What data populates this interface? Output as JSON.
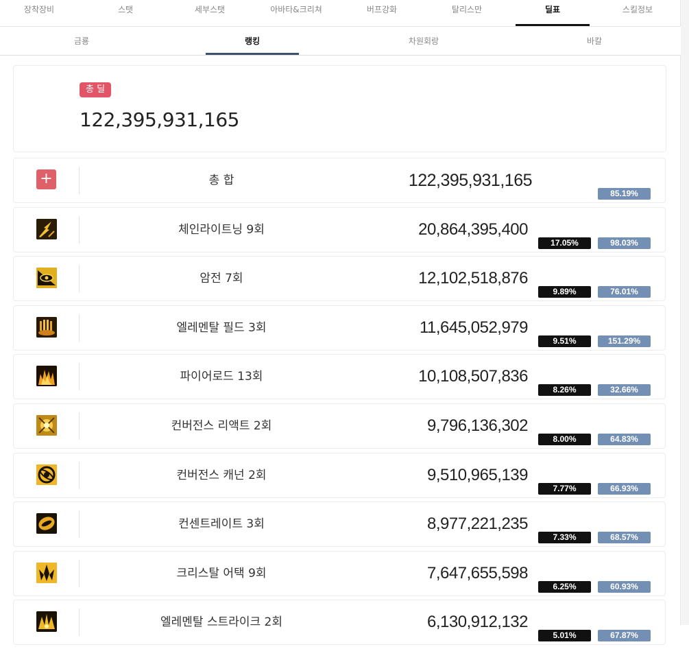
{
  "top_tabs": [
    {
      "label": "장착장비",
      "active": false
    },
    {
      "label": "스탯",
      "active": false
    },
    {
      "label": "세부스탯",
      "active": false
    },
    {
      "label": "아바타&크리쳐",
      "active": false
    },
    {
      "label": "버프강화",
      "active": false
    },
    {
      "label": "탈리스만",
      "active": false
    },
    {
      "label": "딜표",
      "active": true
    },
    {
      "label": "스킬정보",
      "active": false
    }
  ],
  "sub_tabs": [
    {
      "label": "금룡",
      "active": false
    },
    {
      "label": "랭킹",
      "active": true
    },
    {
      "label": "차원회랑",
      "active": false
    },
    {
      "label": "바칼",
      "active": false
    }
  ],
  "total": {
    "badge": "총 딜",
    "value": "122,395,931,165"
  },
  "summary_row": {
    "name": "총 합",
    "value": "122,395,931,165",
    "pct_blue": "85.19%"
  },
  "skills": [
    {
      "name": "체인라이트닝 9회",
      "value": "20,864,395,400",
      "pct_black": "17.05%",
      "pct_blue": "98.03%",
      "icon": "lightning-icon"
    },
    {
      "name": "암전 7회",
      "value": "12,102,518,876",
      "pct_black": "9.89%",
      "pct_blue": "76.01%",
      "icon": "dark-eye-icon"
    },
    {
      "name": "엘레멘탈 필드 3회",
      "value": "11,645,052,979",
      "pct_black": "9.51%",
      "pct_blue": "151.29%",
      "icon": "elemental-field-icon"
    },
    {
      "name": "파이어로드 13회",
      "value": "10,108,507,836",
      "pct_black": "8.26%",
      "pct_blue": "32.66%",
      "icon": "fire-road-icon"
    },
    {
      "name": "컨버전스 리액트 2회",
      "value": "9,796,136,302",
      "pct_black": "8.00%",
      "pct_blue": "64.83%",
      "icon": "convergence-react-icon"
    },
    {
      "name": "컨버전스 캐넌 2회",
      "value": "9,510,965,139",
      "pct_black": "7.77%",
      "pct_blue": "66.93%",
      "icon": "convergence-cannon-icon"
    },
    {
      "name": "컨센트레이트 3회",
      "value": "8,977,221,235",
      "pct_black": "7.33%",
      "pct_blue": "68.57%",
      "icon": "concentrate-icon"
    },
    {
      "name": "크리스탈 어택 9회",
      "value": "7,647,655,598",
      "pct_black": "6.25%",
      "pct_blue": "60.93%",
      "icon": "crystal-attack-icon"
    },
    {
      "name": "엘레멘탈 스트라이크 2회",
      "value": "6,130,912,132",
      "pct_black": "5.01%",
      "pct_blue": "67.87%",
      "icon": "elemental-strike-icon"
    }
  ]
}
